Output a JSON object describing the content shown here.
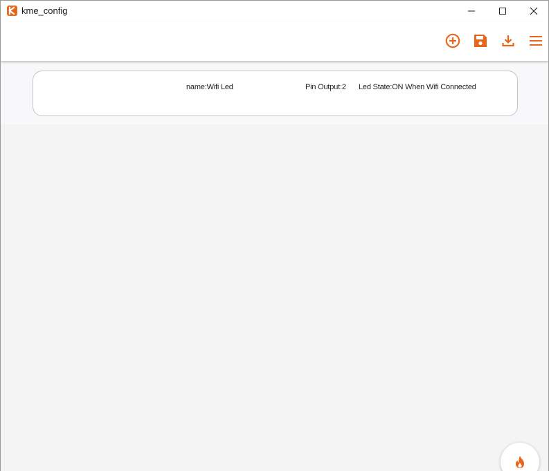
{
  "window": {
    "title": "kme_config",
    "controls": [
      "minimize",
      "maximize",
      "close"
    ]
  },
  "toolbar": {
    "icons": [
      "add-circle-icon",
      "save-icon",
      "download-icon",
      "menu-icon"
    ],
    "accent_color": "#e8661b"
  },
  "items": [
    {
      "name": "name:Wifi Led",
      "pin": "Pin Output:2",
      "led_state": "Led State:ON When Wifi Connected"
    }
  ],
  "fab": {
    "icon": "fire-icon"
  },
  "colors": {
    "accent": "#e8661b",
    "background": "#f5f4f5",
    "card_border": "#c4c4c4"
  }
}
